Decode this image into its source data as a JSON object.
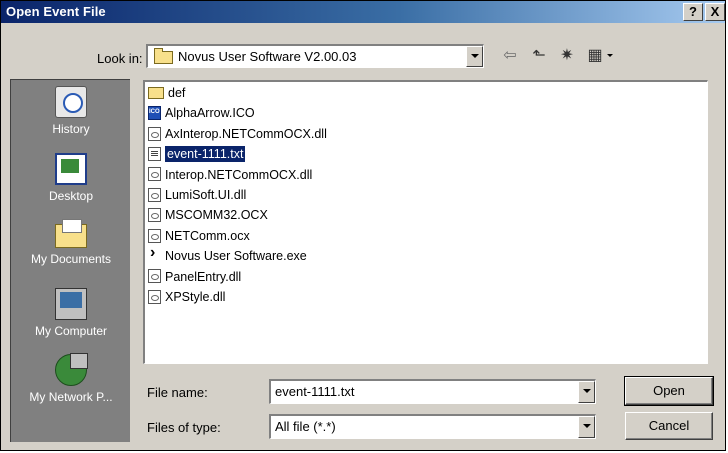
{
  "window": {
    "title": "Open Event File",
    "help_button": "?",
    "close_button": "X"
  },
  "lookin": {
    "label": "Look in:",
    "value": "Novus User Software V2.00.03",
    "icon": "folder-icon"
  },
  "toolbar": {
    "back_icon": "⇦",
    "up_icon": "⬑",
    "newfolder_icon": "✷",
    "views_icon": "▦"
  },
  "places": [
    {
      "label": "History",
      "icon": "history-icon"
    },
    {
      "label": "Desktop",
      "icon": "desktop-icon"
    },
    {
      "label": "My Documents",
      "icon": "my-documents-icon"
    },
    {
      "label": "My Computer",
      "icon": "my-computer-icon"
    },
    {
      "label": "My Network P...",
      "icon": "network-icon"
    }
  ],
  "files": [
    {
      "name": "def",
      "type": "folder"
    },
    {
      "name": "AlphaArrow.ICO",
      "type": "ico"
    },
    {
      "name": "AxInterop.NETCommOCX.dll",
      "type": "dll"
    },
    {
      "name": "event-1111.txt",
      "type": "txt",
      "selected": true
    },
    {
      "name": "Interop.NETCommOCX.dll",
      "type": "dll"
    },
    {
      "name": "LumiSoft.UI.dll",
      "type": "dll"
    },
    {
      "name": "MSCOMM32.OCX",
      "type": "dll"
    },
    {
      "name": "NETComm.ocx",
      "type": "dll"
    },
    {
      "name": "Novus User Software.exe",
      "type": "exe"
    },
    {
      "name": "PanelEntry.dll",
      "type": "dll"
    },
    {
      "name": "XPStyle.dll",
      "type": "dll"
    }
  ],
  "file_name": {
    "label": "File name:",
    "value": "event-1111.txt"
  },
  "file_type": {
    "label": "Files of type:",
    "value": "All file (*.*)"
  },
  "buttons": {
    "open": "Open",
    "cancel": "Cancel"
  },
  "colors": {
    "titlebar_start": "#0a246a",
    "titlebar_end": "#a6caf0",
    "dialog_face": "#d4d0c8",
    "places_bar": "#808080",
    "selection": "#0a246a"
  }
}
